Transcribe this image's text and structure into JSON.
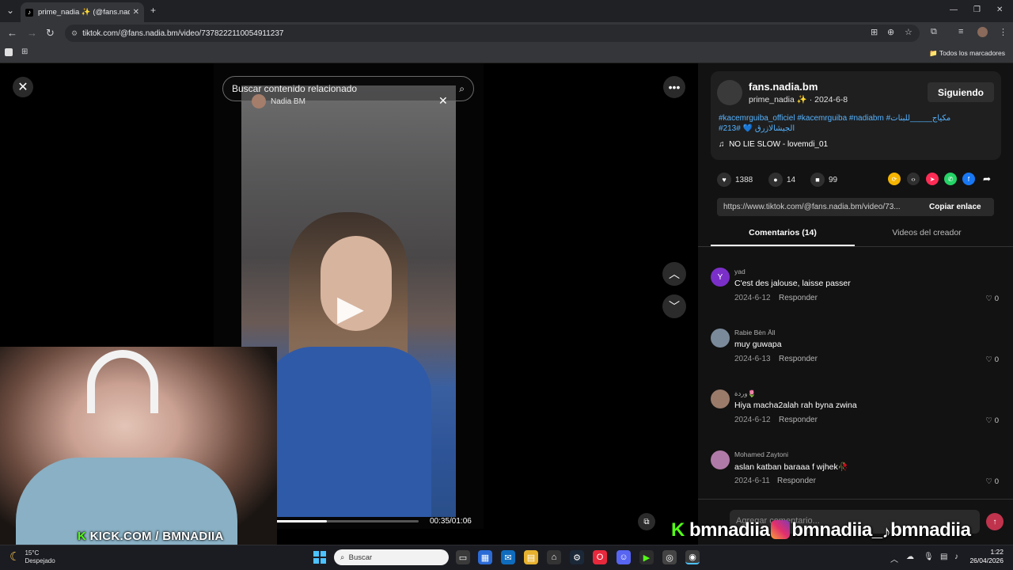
{
  "browser": {
    "tab_title": "prime_nadia ✨ (@fans.nadia.bm",
    "url": "tiktok.com/@fans.nadia.bm/video/7378222110054911237",
    "bookmarks_all": "Todos los marcadores"
  },
  "video": {
    "search_placeholder": "Buscar contenido relacionado",
    "overlay_user": "Nadia BM",
    "time": "00:35/01:06",
    "progress_fraction": 0.37,
    "stream_label_k": "K",
    "stream_label": "KICK.COM / BMNADIIA"
  },
  "post": {
    "author": "fans.nadia.bm",
    "nickname": "prime_nadia ✨",
    "date": "· 2024-6-8",
    "follow_label": "Siguiendo",
    "hashtags_line1": "#kacemrguiba_officiel #kacemrguiba #nadiabm #مكياج_____للبنات",
    "hashtags_line2a": "#الجيشالازرق",
    "hashtags_line2b": "💙 #213",
    "music": "NO LIE SLOW - lovemdi_01",
    "likes": "1388",
    "comments": "14",
    "saves": "99",
    "link": "https://www.tiktok.com/@fans.nadia.bm/video/73...",
    "copy_label": "Copiar enlace"
  },
  "tabs": {
    "comments": "Comentarios (14)",
    "videos": "Videos del creador"
  },
  "comments": [
    {
      "initial": "Y",
      "user": "yad",
      "text": "C'est des jalouse, laisse passer",
      "date": "2024-6-12",
      "reply": "Responder",
      "likes": "0",
      "color": "#7b2fc9"
    },
    {
      "initial": "",
      "user": "Rabie Bèn Äll",
      "text": "muy guwapa",
      "date": "2024-6-13",
      "reply": "Responder",
      "likes": "0",
      "color": "#7a8a9a"
    },
    {
      "initial": "",
      "user": "وردة🌷",
      "text": "Hiya macha2alah rah byna zwina",
      "date": "2024-6-12",
      "reply": "Responder",
      "likes": "0",
      "color": "#9a7b6a"
    },
    {
      "initial": "",
      "user": "Mohamed Zaytoni",
      "text": "aslan katban baraaa f wjhek🥀",
      "date": "2024-6-11",
      "reply": "Responder",
      "likes": "0",
      "color": "#b07aa8"
    }
  ],
  "comment_input_placeholder": "Agregar comentario...",
  "social_overlay": {
    "k": "K",
    "kick": "bmnadiia",
    "ig": "bmnadiia_",
    "tiktok": "bmnadiia"
  },
  "taskbar": {
    "temp": "15°C",
    "weather": "Despejado",
    "search": "Buscar",
    "time": "1:22",
    "date": "26/04/2026"
  }
}
